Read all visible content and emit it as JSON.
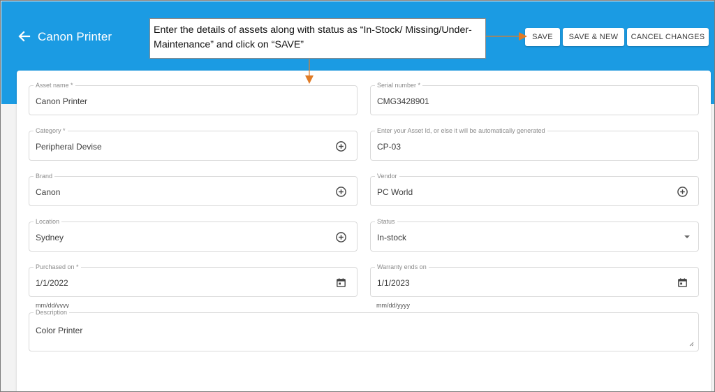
{
  "header": {
    "title": "Canon Printer",
    "back_icon": "arrow-left-icon",
    "bg_color": "#1b9be3"
  },
  "toolbar": {
    "save_label": "SAVE",
    "save_new_label": "SAVE & NEW",
    "cancel_label": "CANCEL CHANGES"
  },
  "callout": {
    "text": "Enter the details of assets along with status as “In-Stock/ Missing/Under-Maintenance” and click on “SAVE”",
    "arrow_color": "#e07b26"
  },
  "form": {
    "asset_name": {
      "label": "Asset name *",
      "value": "Canon Printer"
    },
    "serial_number": {
      "label": "Serial number *",
      "value": "CMG3428901"
    },
    "category": {
      "label": "Category *",
      "value": "Peripheral Devise",
      "icon": "add-circle-icon"
    },
    "asset_id": {
      "label": "Enter your Asset Id, or else it will be automatically generated",
      "value": "CP-03"
    },
    "brand": {
      "label": "Brand",
      "value": "Canon",
      "icon": "add-circle-icon"
    },
    "vendor": {
      "label": "Vendor",
      "value": "PC World",
      "icon": "add-circle-icon"
    },
    "location": {
      "label": "Location",
      "value": "Sydney",
      "icon": "add-circle-icon"
    },
    "status": {
      "label": "Status",
      "value": "In-stock",
      "icon": "dropdown-caret-icon"
    },
    "purchased_on": {
      "label": "Purchased on *",
      "value": "1/1/2022",
      "hint": "mm/dd/yyyy",
      "icon": "calendar-icon"
    },
    "warranty_ends_on": {
      "label": "Warranty ends on",
      "value": "1/1/2023",
      "hint": "mm/dd/yyyy",
      "icon": "calendar-icon"
    },
    "description": {
      "label": "Description",
      "value": "Color Printer"
    }
  }
}
